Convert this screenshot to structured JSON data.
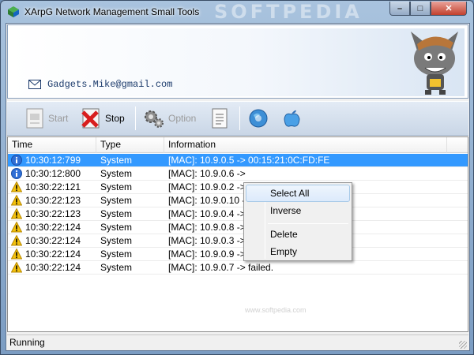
{
  "window": {
    "title": "XArpG Network Management Small Tools",
    "watermark": "SOFTPEDIA"
  },
  "caption": {
    "minimize": "–",
    "maximize": "□",
    "close": "✕"
  },
  "banner": {
    "email": "Gadgets.Mike@gmail.com"
  },
  "toolbar": {
    "start_label": "Start",
    "stop_label": "Stop",
    "option_label": "Option"
  },
  "list": {
    "columns": [
      "Time",
      "Type",
      "Information"
    ],
    "rows": [
      {
        "icon": "info-icon",
        "time": "10:30:12:799",
        "type": "System",
        "info": "[MAC]: 10.9.0.5 -> 00:15:21:0C:FD:FE"
      },
      {
        "icon": "info-icon",
        "time": "10:30:12:800",
        "type": "System",
        "info": "[MAC]: 10.9.0.6 ->"
      },
      {
        "icon": "warning-icon",
        "time": "10:30:22:121",
        "type": "System",
        "info": "[MAC]: 10.9.0.2 ->"
      },
      {
        "icon": "warning-icon",
        "time": "10:30:22:123",
        "type": "System",
        "info": "[MAC]: 10.9.0.10 ->"
      },
      {
        "icon": "warning-icon",
        "time": "10:30:22:123",
        "type": "System",
        "info": "[MAC]: 10.9.0.4 ->"
      },
      {
        "icon": "warning-icon",
        "time": "10:30:22:124",
        "type": "System",
        "info": "[MAC]: 10.9.0.8 ->"
      },
      {
        "icon": "warning-icon",
        "time": "10:30:22:124",
        "type": "System",
        "info": "[MAC]: 10.9.0.3 -> failed."
      },
      {
        "icon": "warning-icon",
        "time": "10:30:22:124",
        "type": "System",
        "info": "[MAC]: 10.9.0.9 -> failed."
      },
      {
        "icon": "warning-icon",
        "time": "10:30:22:124",
        "type": "System",
        "info": "[MAC]: 10.9.0.7 -> failed."
      }
    ]
  },
  "context_menu": {
    "items": [
      "Select All",
      "Inverse",
      "Delete",
      "Empty"
    ],
    "watermark": "www.softpedia.com"
  },
  "status": {
    "text": "Running"
  },
  "colors": {
    "selection": "#3399ff",
    "accent": "#1b3a6b"
  }
}
